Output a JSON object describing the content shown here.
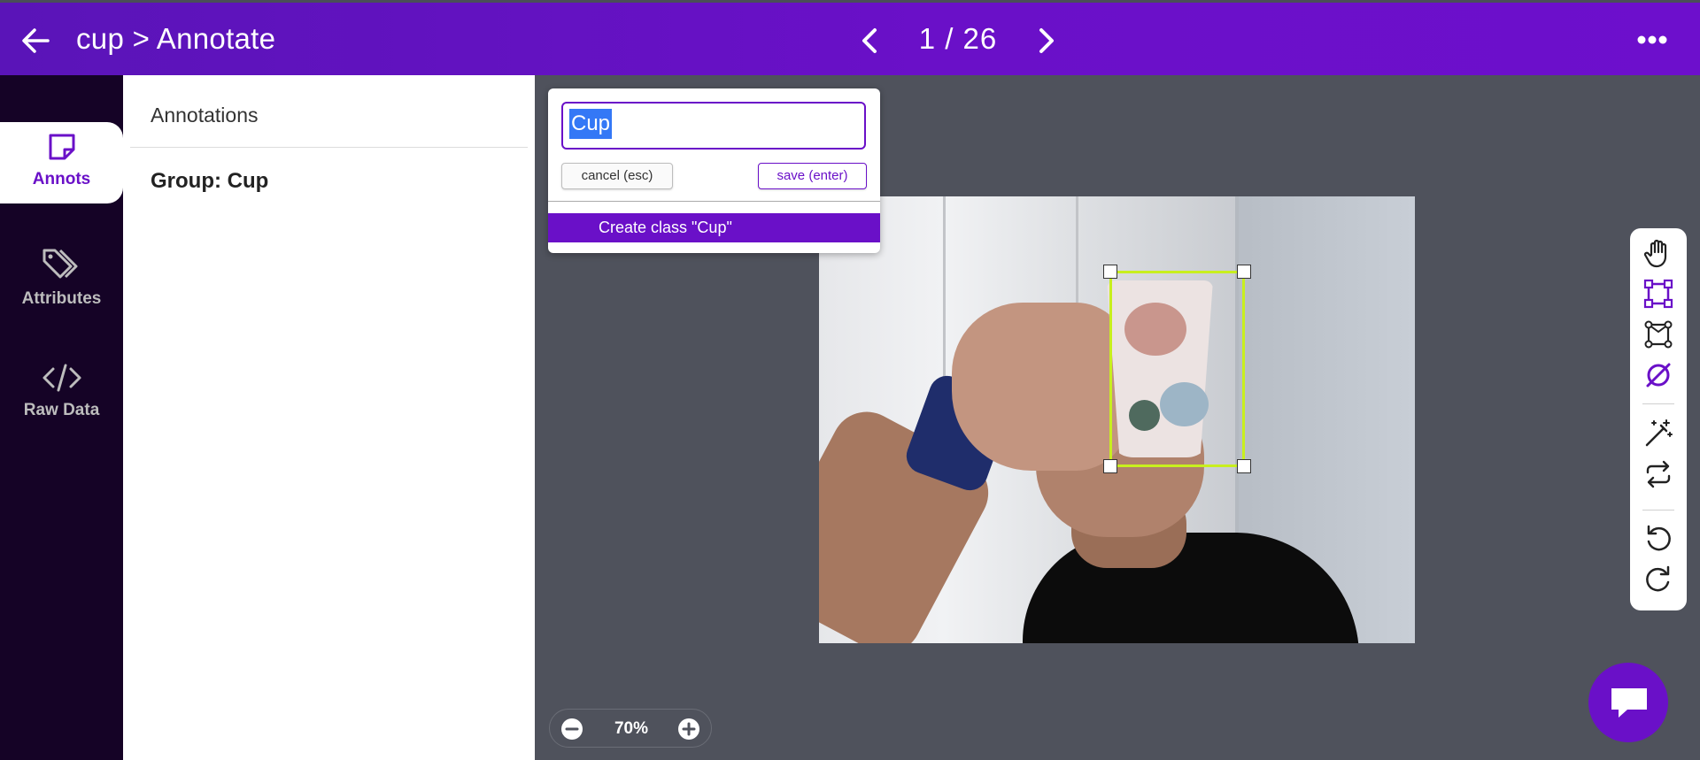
{
  "header": {
    "title": "cup > Annotate",
    "pager": "1 / 26"
  },
  "rail": {
    "items": [
      {
        "label": "Annots",
        "icon": "sticky-note-icon",
        "active": true
      },
      {
        "label": "Attributes",
        "icon": "tags-icon",
        "active": false
      },
      {
        "label": "Raw Data",
        "icon": "code-icon",
        "active": false
      }
    ]
  },
  "panel": {
    "title": "Annotations",
    "group": "Group: Cup"
  },
  "popup": {
    "input_value": "Cup",
    "cancel_label": "cancel (esc)",
    "save_label": "save (enter)",
    "create_label": "Create class \"Cup\""
  },
  "toolbar": {
    "tools": [
      "hand-pan-icon",
      "bounding-box-icon",
      "polygon-icon",
      "no-class-icon",
      "magic-wand-icon",
      "swap-icon",
      "undo-icon",
      "redo-icon"
    ]
  },
  "zoom": {
    "value": "70%"
  },
  "colors": {
    "brand": "#6a10c8",
    "bbox": "#c8ef1e",
    "rail_bg": "#150326",
    "canvas_bg": "#4f525c"
  }
}
